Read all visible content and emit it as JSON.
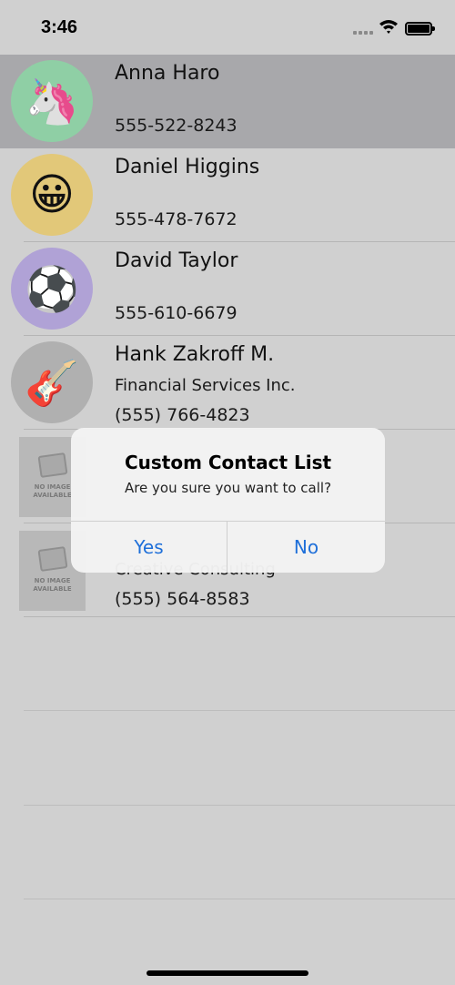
{
  "status_bar": {
    "time": "3:46"
  },
  "contacts": [
    {
      "name": "Anna Haro",
      "company": "",
      "phone": "555-522-8243",
      "avatar_icon": "unicorn-icon",
      "avatar_glyph": "🦄",
      "avatar_bg": "#8fcfa5"
    },
    {
      "name": "Daniel Higgins",
      "company": "",
      "phone": "555-478-7672",
      "avatar_icon": "smiley-icon",
      "avatar_glyph": "😀",
      "avatar_bg": "#e2c879"
    },
    {
      "name": "David Taylor",
      "company": "",
      "phone": "555-610-6679",
      "avatar_icon": "soccer-ball-icon",
      "avatar_glyph": "⚽",
      "avatar_bg": "#b0a2d6"
    },
    {
      "name": "Hank Zakroff M.",
      "company": "Financial Services Inc.",
      "phone": "(555) 766-4823",
      "avatar_icon": "guitar-icon",
      "avatar_glyph": "🎸",
      "avatar_bg": "#b0b0b0"
    },
    {
      "name": "",
      "company": "",
      "phone": "",
      "avatar_icon": "no-image-icon",
      "placeholder_text": "NO IMAGE AVAILABLE"
    },
    {
      "name": "",
      "company": "Creative Consulting",
      "phone": "(555) 564-8583",
      "avatar_icon": "no-image-icon",
      "placeholder_text": "NO IMAGE AVAILABLE"
    }
  ],
  "alert": {
    "title": "Custom Contact List",
    "message": "Are you sure you want to call?",
    "yes_label": "Yes",
    "no_label": "No",
    "button_color": "#1e6fd9"
  },
  "colors": {
    "selected_row": "#a8a8ab",
    "background": "#d0d0d0"
  }
}
